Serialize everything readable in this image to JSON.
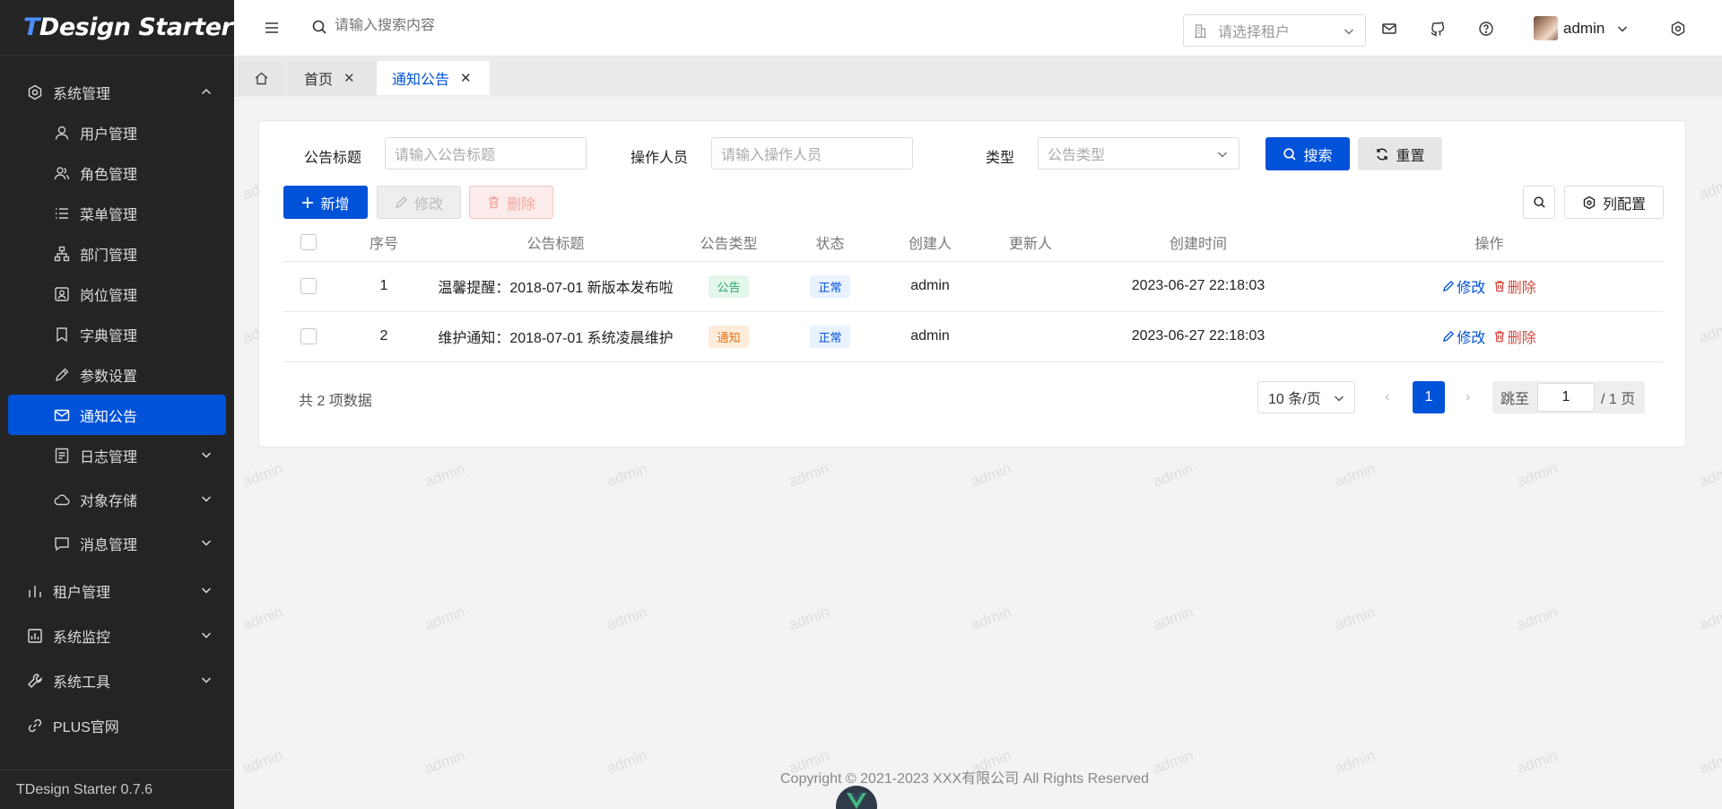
{
  "app": {
    "logo": "TDesign Starter",
    "version": "TDesign Starter 0.7.6"
  },
  "sidebar": {
    "groups": [
      {
        "label": "系统管理",
        "icon": "settings-icon",
        "expanded": true
      },
      {
        "label": "租户管理",
        "icon": "chart-icon"
      },
      {
        "label": "系统监控",
        "icon": "monitor-icon"
      },
      {
        "label": "系统工具",
        "icon": "tool-icon"
      },
      {
        "label": "PLUS官网",
        "icon": "link-icon"
      }
    ],
    "items": [
      {
        "label": "用户管理",
        "icon": "user-icon"
      },
      {
        "label": "角色管理",
        "icon": "users-icon"
      },
      {
        "label": "菜单管理",
        "icon": "menu-icon"
      },
      {
        "label": "部门管理",
        "icon": "org-icon"
      },
      {
        "label": "岗位管理",
        "icon": "badge-icon"
      },
      {
        "label": "字典管理",
        "icon": "bookmark-icon"
      },
      {
        "label": "参数设置",
        "icon": "edit-icon"
      },
      {
        "label": "通知公告",
        "icon": "mail-icon",
        "active": true
      },
      {
        "label": "日志管理",
        "icon": "log-icon"
      },
      {
        "label": "对象存储",
        "icon": "cloud-icon"
      },
      {
        "label": "消息管理",
        "icon": "chat-icon"
      }
    ]
  },
  "header": {
    "search_placeholder": "请输入搜索内容",
    "tenant_placeholder": "请选择租户",
    "username": "admin"
  },
  "tabs": [
    {
      "label": "首页"
    },
    {
      "label": "通知公告",
      "active": true
    }
  ],
  "filters": {
    "title_label": "公告标题",
    "title_placeholder": "请输入公告标题",
    "operator_label": "操作人员",
    "operator_placeholder": "请输入操作人员",
    "type_label": "类型",
    "type_placeholder": "公告类型",
    "search_btn": "搜索",
    "reset_btn": "重置"
  },
  "toolbar": {
    "add": "新增",
    "edit": "修改",
    "delete": "删除",
    "columns": "列配置"
  },
  "table": {
    "headers": [
      "序号",
      "公告标题",
      "公告类型",
      "状态",
      "创建人",
      "更新人",
      "创建时间",
      "操作"
    ],
    "rows": [
      {
        "index": "1",
        "title": "温馨提醒：2018-07-01 新版本发布啦",
        "type": "公告",
        "status": "正常",
        "creator": "admin",
        "updater": "",
        "created": "2023-06-27 22:18:03"
      },
      {
        "index": "2",
        "title": "维护通知：2018-07-01 系统凌晨维护",
        "type": "通知",
        "status": "正常",
        "creator": "admin",
        "updater": "",
        "created": "2023-06-27 22:18:03"
      }
    ],
    "op_edit": "修改",
    "op_delete": "删除"
  },
  "pagination": {
    "total": "共 2 项数据",
    "page_size": "10 条/页",
    "current": "1",
    "jump_label": "跳至",
    "jump_value": "1",
    "total_pages": "/ 1 页"
  },
  "footer": {
    "copyright": "Copyright © 2021-2023 XXX有限公司 All Rights Reserved"
  },
  "watermark": "admin",
  "colors": {
    "primary": "#0052d9",
    "sidebar_bg": "#242424",
    "danger": "#d54941",
    "success": "#2ba471",
    "warning": "#e37318"
  }
}
